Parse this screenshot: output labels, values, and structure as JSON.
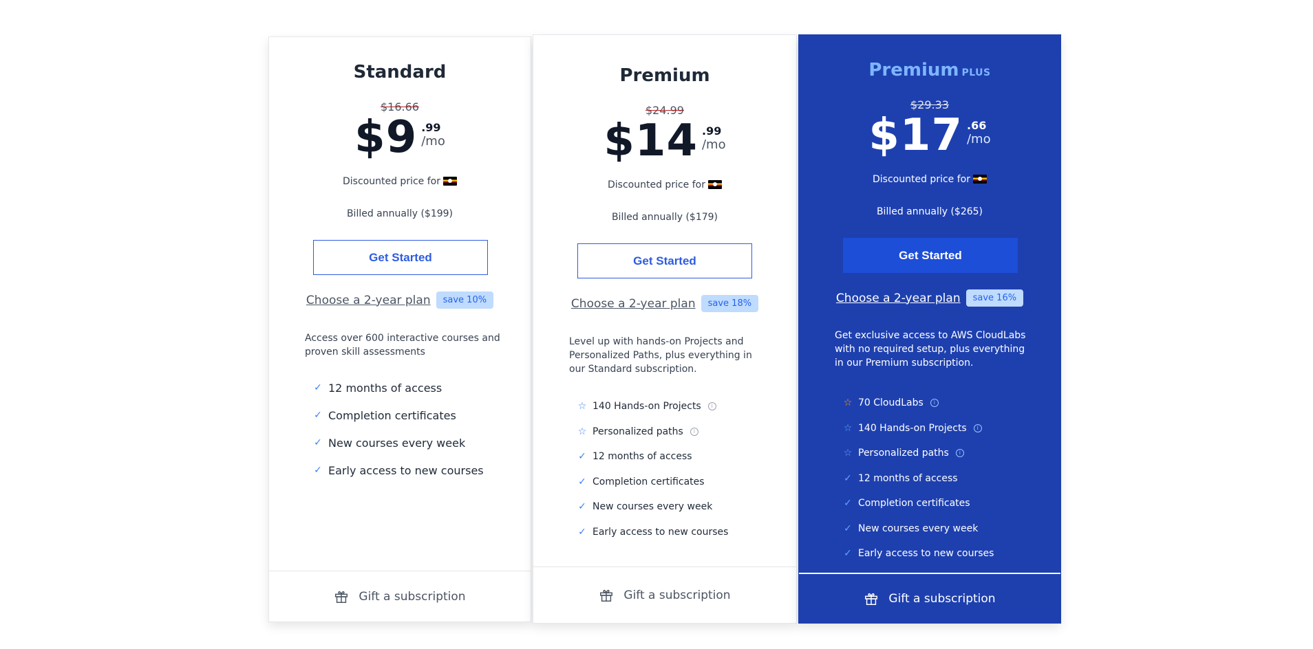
{
  "plans": {
    "standard": {
      "title": "Standard",
      "old_price": "$16.66",
      "price_main": "$9",
      "price_cents": ".99",
      "price_period": "/mo",
      "discount_text": "Discounted price for",
      "billed": "Billed annually ($199)",
      "cta": "Get Started",
      "two_year_link": "Choose a 2-year plan",
      "save_badge": "save 10%",
      "description": "Access over 600 interactive courses and proven skill assessments",
      "features": [
        {
          "label": "12 months of access",
          "mark": "check-icon"
        },
        {
          "label": "Completion certificates",
          "mark": "check-icon"
        },
        {
          "label": "New courses every week",
          "mark": "check-icon"
        },
        {
          "label": "Early access to new courses",
          "mark": "check-icon"
        }
      ],
      "gift": "Gift a subscription"
    },
    "premium": {
      "title": "Premium",
      "old_price": "$24.99",
      "price_main": "$14",
      "price_cents": ".99",
      "price_period": "/mo",
      "discount_text": "Discounted price for",
      "billed": "Billed annually ($179)",
      "cta": "Get Started",
      "two_year_link": "Choose a 2-year plan",
      "save_badge": "save 18%",
      "description": "Level up with hands-on Projects and Personalized Paths, plus everything in our Standard subscription.",
      "features": [
        {
          "label": "140 Hands-on Projects",
          "mark": "star-icon",
          "info": true
        },
        {
          "label": "Personalized paths",
          "mark": "star-icon",
          "info": true
        },
        {
          "label": "12 months of access",
          "mark": "check-icon"
        },
        {
          "label": "Completion certificates",
          "mark": "check-icon"
        },
        {
          "label": "New courses every week",
          "mark": "check-icon"
        },
        {
          "label": "Early access to new courses",
          "mark": "check-icon"
        }
      ],
      "gift": "Gift a subscription"
    },
    "plus": {
      "title": "Premium",
      "title_tag": "PLUS",
      "old_price": "$29.33",
      "price_main": "$17",
      "price_cents": ".66",
      "price_period": "/mo",
      "discount_text": "Discounted price for",
      "billed": "Billed annually ($265)",
      "cta": "Get Started",
      "two_year_link": "Choose a 2-year plan",
      "save_badge": "save 16%",
      "description": "Get exclusive access to AWS CloudLabs with no required setup, plus everything in our Premium subscription.",
      "features": [
        {
          "label": "70 CloudLabs",
          "mark": "star-icon",
          "info": true,
          "gold": true
        },
        {
          "label": "140 Hands-on Projects",
          "mark": "star-icon",
          "info": true
        },
        {
          "label": "Personalized paths",
          "mark": "star-icon",
          "info": true
        },
        {
          "label": "12 months of access",
          "mark": "check-icon"
        },
        {
          "label": "Completion certificates",
          "mark": "check-icon"
        },
        {
          "label": "New courses every week",
          "mark": "check-icon"
        },
        {
          "label": "Early access to new courses",
          "mark": "check-icon"
        }
      ],
      "gift": "Gift a subscription"
    }
  },
  "colors": {
    "accent": "#2d5be3",
    "plus_bg": "#1e40af",
    "plus_title": "#7eb6ff",
    "badge_bg": "#bfdbfe"
  }
}
